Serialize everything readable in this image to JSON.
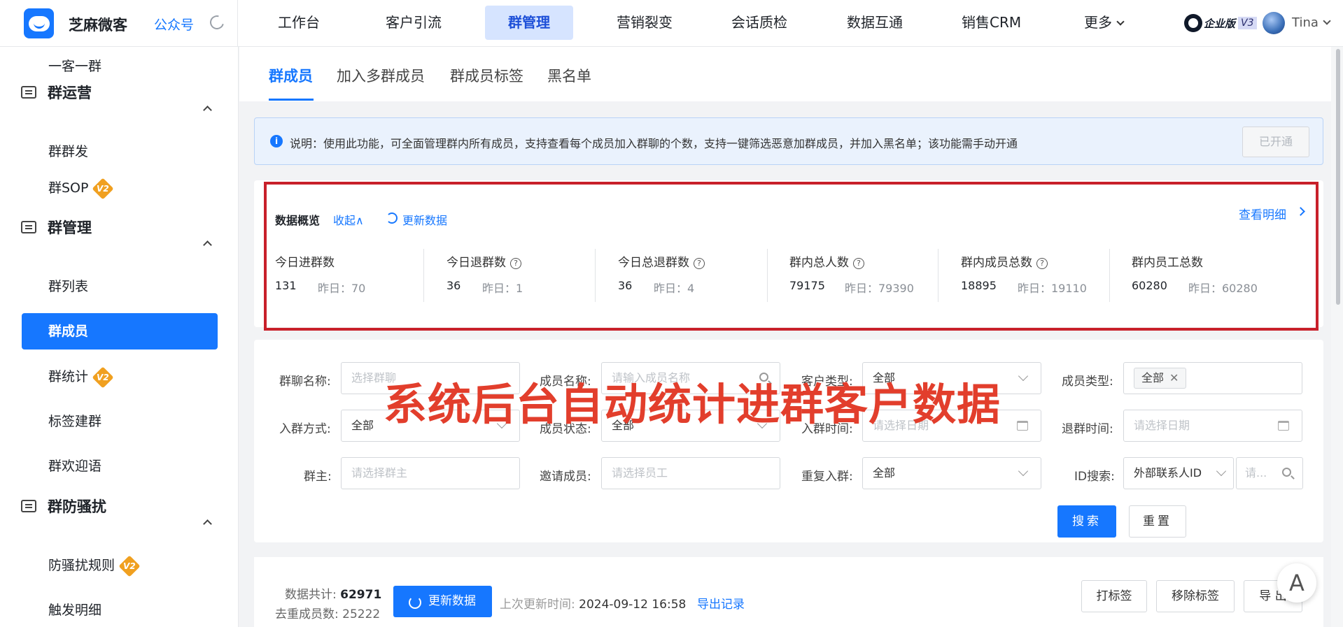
{
  "app": {
    "name": "芝麻微客",
    "official_account": "公众号"
  },
  "nav": {
    "items": [
      "工作台",
      "客户引流",
      "群管理",
      "营销裂变",
      "会话质检",
      "数据互通",
      "销售CRM",
      "更多"
    ],
    "active": "群管理"
  },
  "user": {
    "edition": "企业版",
    "version": "V3",
    "name": "Tina"
  },
  "sidebar": {
    "top_item": "一客一群",
    "groups": [
      {
        "label": "群运营",
        "items": [
          "群群发",
          "群SOP"
        ]
      },
      {
        "label": "群管理",
        "items": [
          "群列表",
          "群成员",
          "群统计",
          "标签建群",
          "群欢迎语"
        ]
      },
      {
        "label": "群防骚扰",
        "items": [
          "防骚扰规则",
          "触发明细"
        ]
      }
    ],
    "badge": "V2",
    "active_item": "群成员"
  },
  "tabs": [
    "群成员",
    "加入多群成员",
    "群成员标签",
    "黑名单"
  ],
  "notice": {
    "text": "说明：使用此功能，可全面管理群内所有成员，支持查看每个成员加入群聊的个数，支持一键筛选恶意加群成员，并加入黑名单；该功能需手动开通",
    "button": "已开通"
  },
  "overview": {
    "title": "数据概览",
    "collapse": "收起∧",
    "refresh": "更新数据",
    "view_detail": "查看明细",
    "metrics": [
      {
        "label": "今日进群数",
        "value": "131",
        "yesterday": "昨日：70"
      },
      {
        "label": "今日退群数",
        "value": "36",
        "yesterday": "昨日：1"
      },
      {
        "label": "今日总退群数",
        "value": "36",
        "yesterday": "昨日：4"
      },
      {
        "label": "群内总人数",
        "value": "79175",
        "yesterday": "昨日：79390"
      },
      {
        "label": "群内成员总数",
        "value": "18895",
        "yesterday": "昨日：19110"
      },
      {
        "label": "群内员工总数",
        "value": "60280",
        "yesterday": "昨日：60280"
      }
    ]
  },
  "filter": {
    "group_name": {
      "label": "群聊名称:",
      "placeholder": "选择群聊"
    },
    "member_name": {
      "label": "成员名称:",
      "placeholder": "请输入成员名称"
    },
    "customer_type": {
      "label": "客户类型:",
      "value": "全部"
    },
    "member_type": {
      "label": "成员类型:",
      "tag": "全部"
    },
    "join_method": {
      "label": "入群方式:",
      "value": "全部"
    },
    "member_status": {
      "label": "成员状态:",
      "value": "全部"
    },
    "join_time": {
      "label": "入群时间:",
      "placeholder": "请选择日期"
    },
    "quit_time": {
      "label": "退群时间:",
      "placeholder": "请选择日期"
    },
    "owner": {
      "label": "群主:",
      "placeholder": "请选择群主"
    },
    "inviter": {
      "label": "邀请成员:",
      "placeholder": "请选择员工"
    },
    "rejoin": {
      "label": "重复入群:",
      "value": "全部"
    },
    "id_search": {
      "label": "ID搜索:",
      "type": "外部联系人ID",
      "placeholder": "请..."
    },
    "search": "搜索",
    "reset": "重置"
  },
  "caption": "系统后台自动统计进群客户数据",
  "bottom": {
    "total_label": "数据共计:",
    "total": "62971",
    "dedup_label": "去重成员数:",
    "dedup": "25222",
    "refresh": "更新数据",
    "last_update_label": "上次更新时间:",
    "last_update": "2024-09-12 16:58",
    "export_record": "导出记录",
    "tag_btn": "打标签",
    "untag_btn": "移除标签",
    "export_btn": "导 出"
  },
  "float_button": "A"
}
